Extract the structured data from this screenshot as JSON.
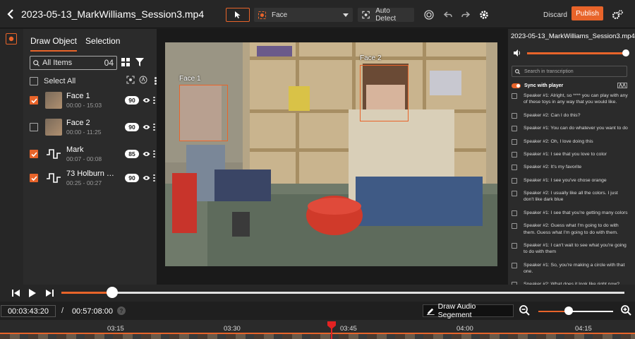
{
  "header": {
    "title": "2023-05-13_MarkWilliams_Session3.mp4",
    "detect_type": "Face",
    "auto_detect_label": "Auto Detect",
    "discard_label": "Discard",
    "publish_label": "Publish"
  },
  "left_panel": {
    "tabs": [
      {
        "label": "Draw Object"
      },
      {
        "label": "Selection"
      }
    ],
    "filter_label": "All Items",
    "filter_count": "04",
    "select_all_label": "Select All",
    "items": [
      {
        "name": "Face 1",
        "time": "00:00 - 15:03",
        "score": "90",
        "checked": true,
        "kind": "face"
      },
      {
        "name": "Face 2",
        "time": "00:00 - 11:25",
        "score": "90",
        "checked": false,
        "kind": "face"
      },
      {
        "name": "Mark",
        "time": "00:07 - 00:08",
        "score": "85",
        "checked": true,
        "kind": "audio"
      },
      {
        "name": "73 Holburn Stre...",
        "time": "00:25 - 00:27",
        "score": "90",
        "checked": true,
        "kind": "audio"
      }
    ]
  },
  "video": {
    "boxes": [
      {
        "label": "Face 1"
      },
      {
        "label": "Face 2"
      }
    ]
  },
  "transcript": {
    "title": "2023-05-13_MarkWilliams_Session3.mp4",
    "volume": 1.0,
    "search_placeholder": "Search in transcription",
    "sync_label": "Sync with player",
    "lines": [
      "Speaker #1: Alright, so **** you can play with any of these toys in any way that you would like.",
      "Speaker #2: Can I do this?",
      "Speaker #1: You can do whatever you want to do",
      "Speaker #2: Oh, I love doing this",
      "Speaker #1: I see that you love to color",
      "Speaker #2: It's my favorite",
      "Speaker #1: I see you've chose orange",
      "Speaker #2: I usually like all the colors. I just don't like dark blue",
      "Speaker #1: I see that you're getting many colors",
      "Speaker #2: Guess what I'm going to do with them. Guess what I'm going to do with them.",
      "Speaker #1: I can't wait to see what you're going to do with them",
      "Speaker #1: So, you're making a circle with that one.",
      "Speaker #2: What does it look like right now?"
    ]
  },
  "player": {
    "progress": 0.0898,
    "current_time": "00:03:43:20",
    "total_time": "00:57:08:00",
    "help": "?",
    "draw_audio_label": "Draw Audio Segement",
    "zoom_level": 0.4,
    "ruler_ticks": [
      "03:15",
      "03:30",
      "03:45",
      "04:00",
      "04:15"
    ]
  },
  "colors": {
    "accent": "#e8642a",
    "panel": "#2b2b2b",
    "bar": "#262626"
  }
}
